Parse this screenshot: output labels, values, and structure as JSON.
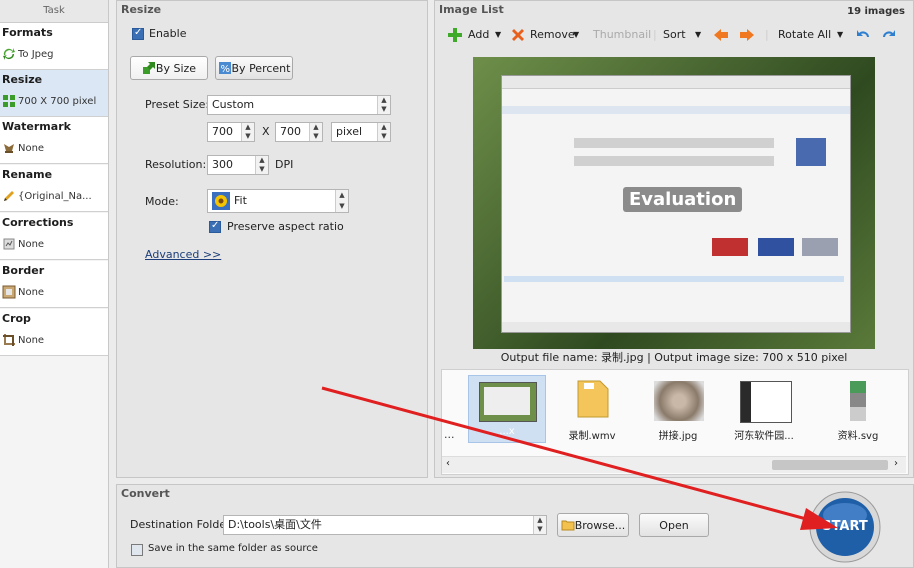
{
  "tasks": {
    "header": "Task",
    "items": [
      {
        "title": "Formats",
        "value": "To Jpeg",
        "icon": "recycle-arrows-icon",
        "color": "#4aa832"
      },
      {
        "title": "Resize",
        "value": "700 X 700 pixel",
        "icon": "resize-grid-icon",
        "color": "#3c9c2a"
      },
      {
        "title": "Watermark",
        "value": "None",
        "icon": "watermark-stamp-icon",
        "color": "#8c6b3a"
      },
      {
        "title": "Rename",
        "value": "{Original_Na...",
        "icon": "pencil-icon",
        "color": "#e0a020"
      },
      {
        "title": "Corrections",
        "value": "None",
        "icon": "corrections-icon",
        "color": "#888888"
      },
      {
        "title": "Border",
        "value": "None",
        "icon": "border-frame-icon",
        "color": "#9a7a50"
      },
      {
        "title": "Crop",
        "value": "None",
        "icon": "crop-icon",
        "color": "#9a7a50"
      }
    ]
  },
  "resize": {
    "title": "Resize",
    "enable_label": "Enable",
    "by_size": "By Size",
    "by_percent": "By Percent",
    "preset_label": "Preset Size:",
    "preset_value": "Custom",
    "width": "700",
    "x_label": "X",
    "height": "700",
    "unit": "pixel",
    "resolution_label": "Resolution:",
    "resolution": "300",
    "dpi": "DPI",
    "mode_label": "Mode:",
    "mode_value": "Fit",
    "preserve_label": "Preserve aspect ratio",
    "advanced": "Advanced >>"
  },
  "image_list": {
    "title": "Image List",
    "count": "19 images",
    "toolbar": {
      "add": "Add",
      "remove": "Remove",
      "thumbnail": "Thumbnail",
      "sort": "Sort",
      "rotate_all": "Rotate All"
    },
    "preview_watermark": "Evaluation",
    "output_info": "Output file name: 录制.jpg | Output image size: 700 x 510 pixel",
    "thumbnails": [
      {
        "name": "...ⅹ",
        "selected": true
      },
      {
        "name": "录制.wmv",
        "selected": false
      },
      {
        "name": "拼接.jpg",
        "selected": false
      },
      {
        "name": "河东软件园...",
        "selected": false
      },
      {
        "name": "资料.svg",
        "selected": false
      }
    ],
    "left_ellipsis": "..."
  },
  "convert": {
    "title": "Convert",
    "dest_label": "Destination Folder:",
    "dest_value": "D:\\tools\\桌面\\文件",
    "browse": "Browse...",
    "open": "Open",
    "same_folder": "Save in the same folder as source",
    "start": "START"
  },
  "colors": {
    "accent_arrow": "#e02020",
    "start_blue": "#1f5fa8",
    "selection": "#cfe0f3"
  }
}
